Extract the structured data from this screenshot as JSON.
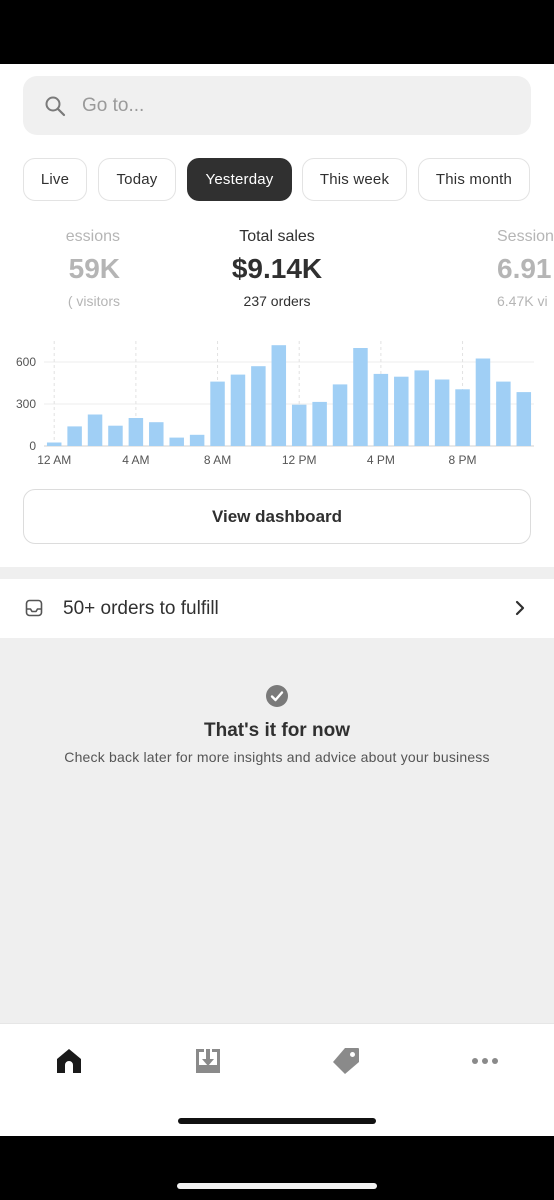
{
  "search": {
    "placeholder": "Go to..."
  },
  "filters": [
    {
      "label": "Live",
      "active": false
    },
    {
      "label": "Today",
      "active": false
    },
    {
      "label": "Yesterday",
      "active": true
    },
    {
      "label": "This week",
      "active": false
    },
    {
      "label": "This month",
      "active": false
    }
  ],
  "metrics": {
    "left": {
      "label": "essions",
      "value": "59K",
      "sub": "( visitors"
    },
    "center": {
      "label": "Total sales",
      "value": "$9.14K",
      "sub": "237 orders"
    },
    "right": {
      "label": "Session",
      "value": "6.91",
      "sub": "6.47K vi"
    }
  },
  "chart_data": {
    "type": "bar",
    "x_tick_labels": [
      "12 AM",
      "4 AM",
      "8 AM",
      "12 PM",
      "4 PM",
      "8 PM"
    ],
    "y_tick_labels": [
      "0",
      "300",
      "600"
    ],
    "ylim": [
      0,
      750
    ],
    "grid": true,
    "categories": [
      "12 AM",
      "1 AM",
      "2 AM",
      "3 AM",
      "4 AM",
      "5 AM",
      "6 AM",
      "7 AM",
      "8 AM",
      "9 AM",
      "10 AM",
      "11 AM",
      "12 PM",
      "1 PM",
      "2 PM",
      "3 PM",
      "4 PM",
      "5 PM",
      "6 PM",
      "7 PM",
      "8 PM",
      "9 PM",
      "10 PM",
      "11 PM"
    ],
    "values": [
      25,
      140,
      225,
      145,
      200,
      170,
      60,
      80,
      460,
      510,
      570,
      720,
      295,
      315,
      440,
      700,
      515,
      495,
      540,
      475,
      405,
      625,
      460,
      385
    ],
    "bar_color": "#a0cff5"
  },
  "view_dashboard": "View dashboard",
  "fulfill": {
    "label": "50+ orders to fulfill"
  },
  "empty_state": {
    "title": "That's it for now",
    "description": "Check back later for more insights and advice about your business"
  },
  "tabs": [
    {
      "icon": "home-icon",
      "active": true
    },
    {
      "icon": "orders-inbox-icon",
      "active": false
    },
    {
      "icon": "products-tag-icon",
      "active": false
    },
    {
      "icon": "more-icon",
      "active": false
    }
  ]
}
